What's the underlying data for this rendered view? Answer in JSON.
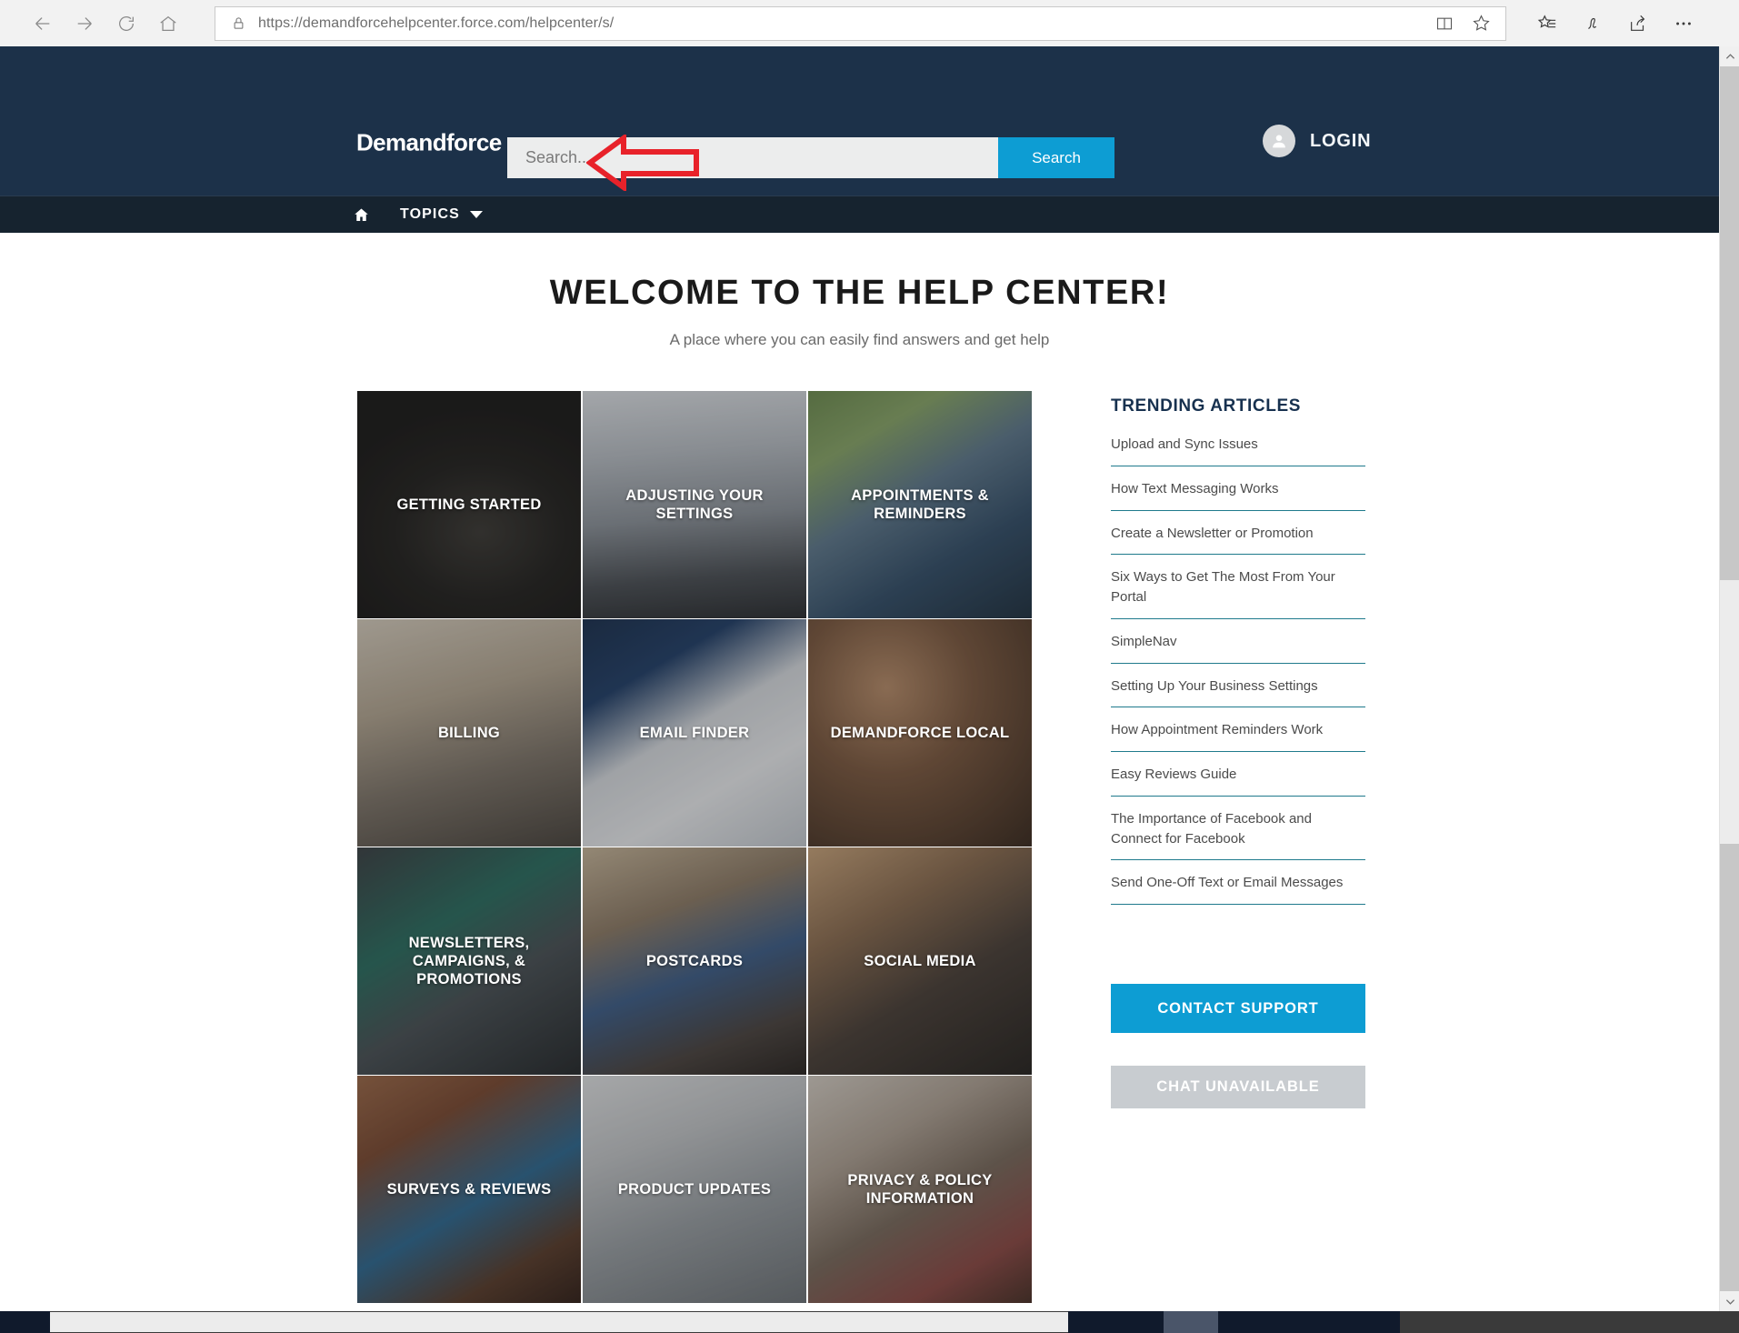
{
  "browser": {
    "url": "https://demandforcehelpcenter.force.com/helpcenter/s/",
    "icons": {
      "back": "back-arrow-icon",
      "forward": "forward-arrow-icon",
      "refresh": "refresh-icon",
      "home": "home-icon",
      "lock": "lock-icon",
      "reading_view": "reading-view-icon",
      "favorites_star": "favorites-star-icon",
      "hub": "hub-icon",
      "web_note": "web-note-pen-icon",
      "share": "share-icon",
      "more": "more-ellipsis-icon"
    }
  },
  "header": {
    "logo": "Demandforce",
    "search": {
      "placeholder": "Search...",
      "value": "",
      "button_label": "Search"
    },
    "login_label": "LOGIN",
    "avatar_icon": "user-avatar-icon",
    "annotation_icon": "red-left-arrow-annotation"
  },
  "nav": {
    "home_icon": "home-icon",
    "topics_label": "TOPICS",
    "caret_icon": "chevron-down-icon"
  },
  "main": {
    "title": "WELCOME TO THE HELP CENTER!",
    "subtitle": "A place where you can easily find answers and get help",
    "tiles": [
      {
        "label": "GETTING STARTED",
        "photo": "p-keyboard"
      },
      {
        "label": "ADJUSTING YOUR SETTINGS",
        "photo": "p-mixer"
      },
      {
        "label": "APPOINTMENTS & REMINDERS",
        "photo": "p-phone"
      },
      {
        "label": "BILLING",
        "photo": "p-billing"
      },
      {
        "label": "EMAIL FINDER",
        "photo": "p-email"
      },
      {
        "label": "DEMANDFORCE LOCAL",
        "photo": "p-local"
      },
      {
        "label": "NEWSLETTERS, CAMPAIGNS, & PROMOTIONS",
        "photo": "p-news"
      },
      {
        "label": "POSTCARDS",
        "photo": "p-postcards"
      },
      {
        "label": "SOCIAL MEDIA",
        "photo": "p-social"
      },
      {
        "label": "SURVEYS & REVIEWS",
        "photo": "p-surveys"
      },
      {
        "label": "PRODUCT UPDATES",
        "photo": "p-product"
      },
      {
        "label": "PRIVACY & POLICY INFORMATION",
        "photo": "p-privacy"
      }
    ]
  },
  "sidebar": {
    "trending_title": "TRENDING ARTICLES",
    "articles": [
      "Upload and Sync Issues",
      "How Text Messaging Works",
      "Create a Newsletter or Promotion",
      "Six Ways to Get The Most From Your Portal",
      "SimpleNav",
      "Setting Up Your Business Settings",
      "How Appointment Reminders Work",
      "Easy Reviews Guide",
      "The Importance of Facebook and Connect for Facebook",
      "Send One-Off Text or Email Messages"
    ],
    "contact_support_label": "CONTACT SUPPORT",
    "chat_unavailable_label": "CHAT UNAVAILABLE"
  },
  "colors": {
    "header_navy": "#1c3149",
    "topics_bar": "#16232f",
    "accent_blue": "#0d9dd3",
    "divider_teal": "#1f7a8c",
    "disabled_gray": "#c8ccd0",
    "annotation_red": "#e8222a"
  }
}
